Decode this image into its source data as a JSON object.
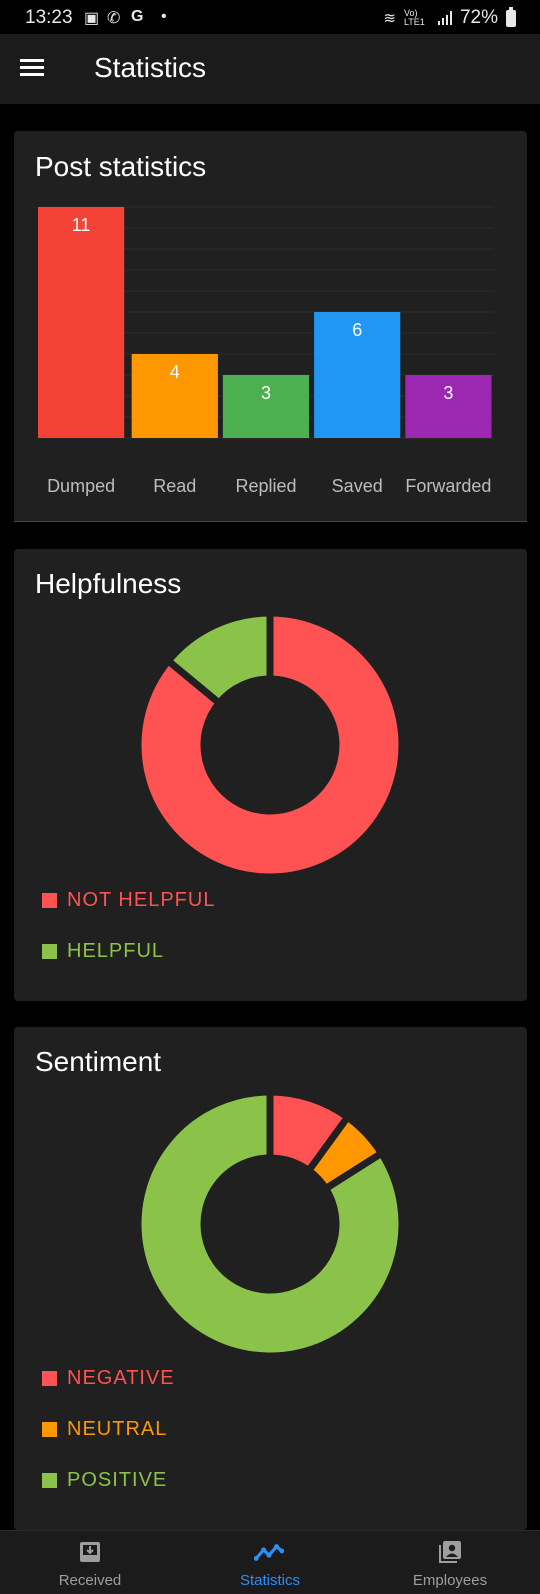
{
  "status_bar": {
    "time": "13:23",
    "network": "Vo) LTE1",
    "battery": "72%",
    "icons": [
      "image-icon",
      "whatsapp-icon",
      "google-icon",
      "dot-icon",
      "wifi-icon",
      "signal-icon",
      "battery-icon"
    ]
  },
  "appbar": {
    "title": "Statistics",
    "menu_icon": "hamburger-icon"
  },
  "post_stats": {
    "title": "Post statistics",
    "chart_data": {
      "type": "bar",
      "categories": [
        "Dumped",
        "Read",
        "Replied",
        "Saved",
        "Forwarded"
      ],
      "values": [
        11,
        4,
        3,
        6,
        3
      ],
      "colors": [
        "#f44336",
        "#ff9800",
        "#4caf50",
        "#2196f3",
        "#9c27b0"
      ],
      "ylim": [
        0,
        11
      ],
      "grid": true
    }
  },
  "helpfulness": {
    "title": "Helpfulness",
    "chart_data": {
      "type": "pie",
      "donut": true,
      "labels": [
        "NOT HELPFUL",
        "HELPFUL"
      ],
      "values": [
        86,
        14
      ],
      "colors": [
        "#ff5252",
        "#8bc34a"
      ]
    }
  },
  "sentiment": {
    "title": "Sentiment",
    "chart_data": {
      "type": "pie",
      "donut": true,
      "labels": [
        "NEGATIVE",
        "NEUTRAL",
        "POSITIVE"
      ],
      "values": [
        10,
        6,
        84
      ],
      "colors": [
        "#ff5252",
        "#ff9800",
        "#8bc34a"
      ]
    }
  },
  "bottom_nav": {
    "items": [
      {
        "label": "Received",
        "icon": "inbox-icon",
        "active": false
      },
      {
        "label": "Statistics",
        "icon": "trending-icon",
        "active": true
      },
      {
        "label": "Employees",
        "icon": "contacts-icon",
        "active": false
      }
    ],
    "active_color": "#2f8df5"
  }
}
